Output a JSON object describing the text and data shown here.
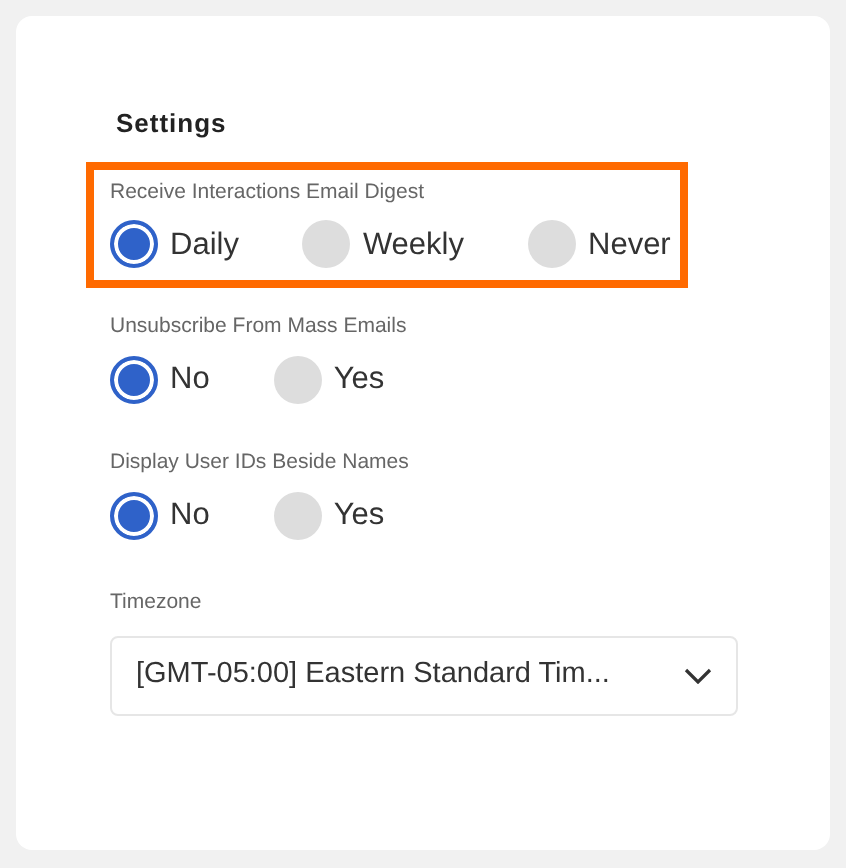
{
  "title": "Settings",
  "groups": [
    {
      "label": "Receive Interactions Email Digest",
      "highlighted": true,
      "options": [
        {
          "label": "Daily",
          "selected": true
        },
        {
          "label": "Weekly",
          "selected": false
        },
        {
          "label": "Never",
          "selected": false
        }
      ]
    },
    {
      "label": "Unsubscribe From Mass Emails",
      "highlighted": false,
      "options": [
        {
          "label": "No",
          "selected": true
        },
        {
          "label": "Yes",
          "selected": false
        }
      ]
    },
    {
      "label": "Display User IDs Beside Names",
      "highlighted": false,
      "options": [
        {
          "label": "No",
          "selected": true
        },
        {
          "label": "Yes",
          "selected": false
        }
      ]
    }
  ],
  "timezone": {
    "label": "Timezone",
    "value": "[GMT-05:00] Eastern Standard Tim..."
  }
}
